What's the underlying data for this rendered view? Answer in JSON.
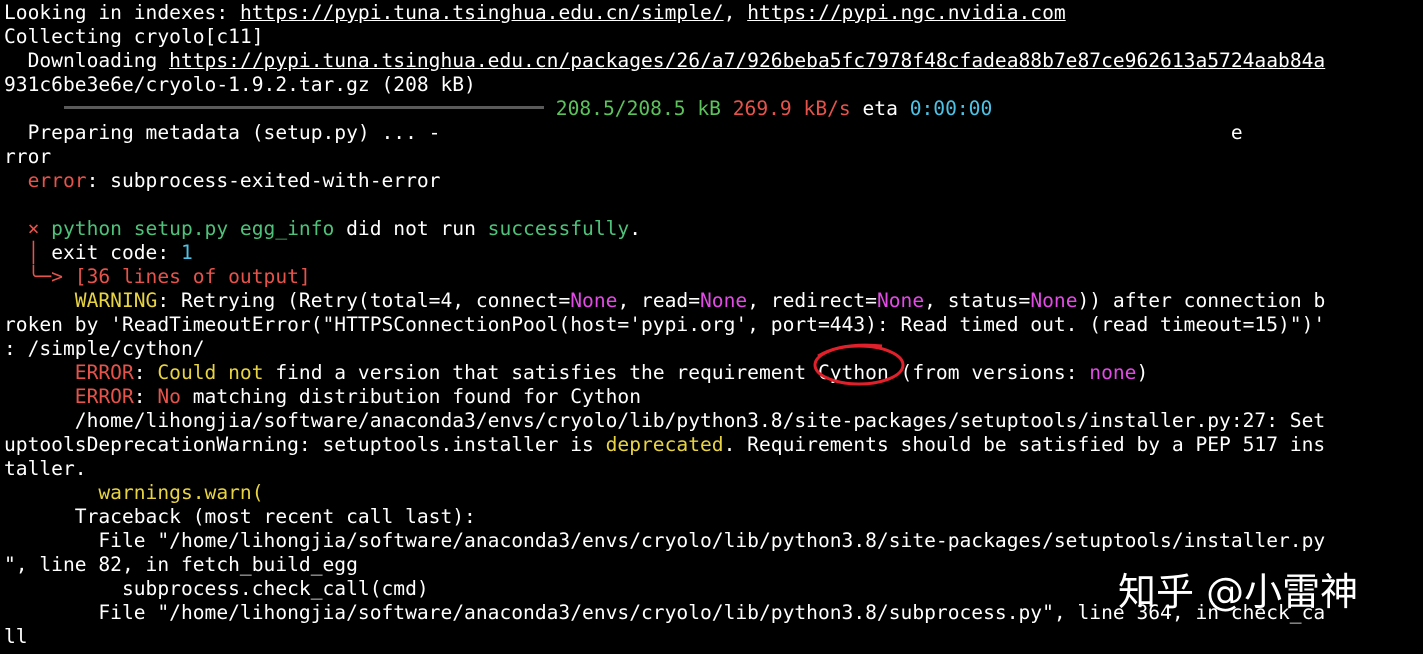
{
  "lines": {
    "l1_a": "Looking in indexes: ",
    "l1_link1": "https://pypi.tuna.tsinghua.edu.cn/simple/",
    "l1_sep": ", ",
    "l1_link2": "https://pypi.ngc.nvidia.com",
    "l2": "Collecting cryolo[c11]",
    "l3_a": "  Downloading ",
    "l3_link": "https://pypi.tuna.tsinghua.edu.cn/packages/26/a7/926beba5fc7978f48cfadea88b7e87ce962613a5724aab84a",
    "l4": "931c6be3e6e/cryolo-1.9.2.tar.gz (208 kB)",
    "progress_size": "208.5/208.5 kB",
    "progress_speed": "269.9 kB/s",
    "progress_eta_label": "eta",
    "progress_eta": "0:00:00",
    "l6": "  Preparing metadata (setup.py) ... -                                                                   e",
    "l7": "rror",
    "l8_prefix": "  ",
    "l8_err": "error",
    "l8_rest": ": subprocess-exited-with-error",
    "l10_prefix": "  ",
    "l10_x": "×",
    "l10_cmd": " python setup.py egg_info",
    "l10_mid": " did not run ",
    "l10_ok": "successfully",
    "l10_end": ".",
    "l11_tree": "  │ ",
    "l11_label": "exit code: ",
    "l11_code": "1",
    "l12_tree": "  ╰─> ",
    "l12_out": "[36 lines of output]",
    "l13_indent": "      ",
    "l13_warn": "WARNING",
    "l13_a": ": Retrying (Retry(total=4, connect=",
    "l13_none1": "None",
    "l13_b": ", read=",
    "l13_none2": "None",
    "l13_c": ", redirect=",
    "l13_none3": "None",
    "l13_d": ", status=",
    "l13_none4": "None",
    "l13_e": ")) after connection b",
    "l14": "roken by 'ReadTimeoutError(\"HTTPSConnectionPool(host='pypi.org', port=443): Read timed out. (read timeout=15)\")'",
    "l15": ": /simple/cython/",
    "l16_indent": "      ",
    "l16_err": "ERROR",
    "l16_colon": ": ",
    "l16_could": "Could not",
    "l16_a": " find a version that satisfies the requirement Cython (from versions: ",
    "l16_none": "none",
    "l16_end": ")",
    "l17_indent": "      ",
    "l17_err": "ERROR",
    "l17_colon": ": ",
    "l17_no": "No",
    "l17_a": " matching distribution found for Cython",
    "l18": "      /home/lihongjia/software/anaconda3/envs/cryolo/lib/python3.8/site-packages/setuptools/installer.py:27: Set",
    "l19_a": "uptoolsDeprecationWarning: setuptools.installer is ",
    "l19_dep": "deprecated",
    "l19_b": ". Requirements should be satisfied by a PEP 517 ins",
    "l20": "taller.",
    "l21_indent": "        ",
    "l21_warn": "warnings.warn(",
    "l22": "      Traceback (most recent call last):",
    "l23": "        File \"/home/lihongjia/software/anaconda3/envs/cryolo/lib/python3.8/site-packages/setuptools/installer.py",
    "l24": "\", line 82, in fetch_build_egg",
    "l25": "          subprocess.check_call(cmd)",
    "l26": "        File \"/home/lihongjia/software/anaconda3/envs/cryolo/lib/python3.8/subprocess.py\", line 364, in check_ca",
    "l27": "ll"
  },
  "watermark": "知乎 @小雷神",
  "colors": {
    "background": "#000000",
    "text": "#ffffff",
    "green": "#4ec27a",
    "red": "#e5534b",
    "yellow": "#e8d442",
    "magenta": "#e24be6",
    "cyan": "#4cc3e6",
    "annotation_red": "#e0202a"
  }
}
